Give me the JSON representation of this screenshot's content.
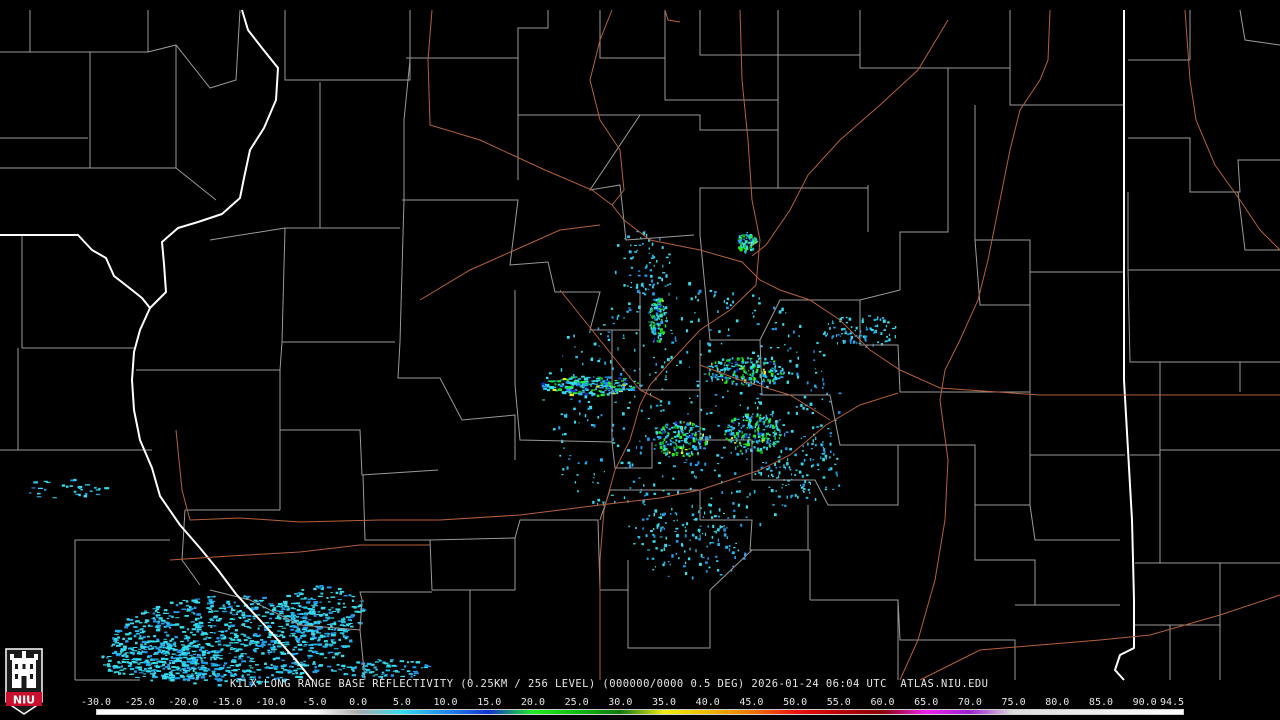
{
  "product": {
    "station": "KILX",
    "description": "KILX LONG RANGE BASE REFLECTIVITY (0.25KM / 256 LEVEL) (000000/0000 0.5 DEG) 2026-01-24 06:04 UTC  ATLAS.NIU.EDU",
    "datetime": "2026-01-24 06:04 UTC",
    "source": "ATLAS.NIU.EDU",
    "elevation": "0.5 DEG"
  },
  "logo": {
    "text": "NIU",
    "color": "#c8102e"
  },
  "colors": {
    "background": "#000000",
    "county_lines": "#9a9a9a",
    "state_lines": "#ffffff",
    "roads": "#b5603a"
  },
  "scale": {
    "labels": [
      "-30.0",
      "-25.0",
      "-20.0",
      "-15.0",
      "-10.0",
      "-5.0",
      "0.0",
      "5.0",
      "10.0",
      "15.0",
      "20.0",
      "25.0",
      "30.0",
      "35.0",
      "40.0",
      "45.0",
      "50.0",
      "55.0",
      "60.0",
      "65.0",
      "70.0",
      "75.0",
      "80.0",
      "85.0",
      "90.0",
      "94.5"
    ],
    "stops": [
      {
        "dbz": -30,
        "color": "#ffffff"
      },
      {
        "dbz": -5,
        "color": "#ffffff"
      },
      {
        "dbz": 0,
        "color": "#aaaaaa"
      },
      {
        "dbz": 5,
        "color": "#33ddee"
      },
      {
        "dbz": 10,
        "color": "#2288ee"
      },
      {
        "dbz": 15,
        "color": "#1133cc"
      },
      {
        "dbz": 20,
        "color": "#22ee22"
      },
      {
        "dbz": 25,
        "color": "#11bb11"
      },
      {
        "dbz": 30,
        "color": "#117711"
      },
      {
        "dbz": 35,
        "color": "#eeee11"
      },
      {
        "dbz": 40,
        "color": "#eebb00"
      },
      {
        "dbz": 45,
        "color": "#ee7700"
      },
      {
        "dbz": 50,
        "color": "#ee1111"
      },
      {
        "dbz": 55,
        "color": "#bb0000"
      },
      {
        "dbz": 60,
        "color": "#880000"
      },
      {
        "dbz": 65,
        "color": "#ee22ee"
      },
      {
        "dbz": 70,
        "color": "#9922cc"
      },
      {
        "dbz": 75,
        "color": "#dddddd"
      },
      {
        "dbz": 94.5,
        "color": "#ffffff"
      }
    ]
  }
}
